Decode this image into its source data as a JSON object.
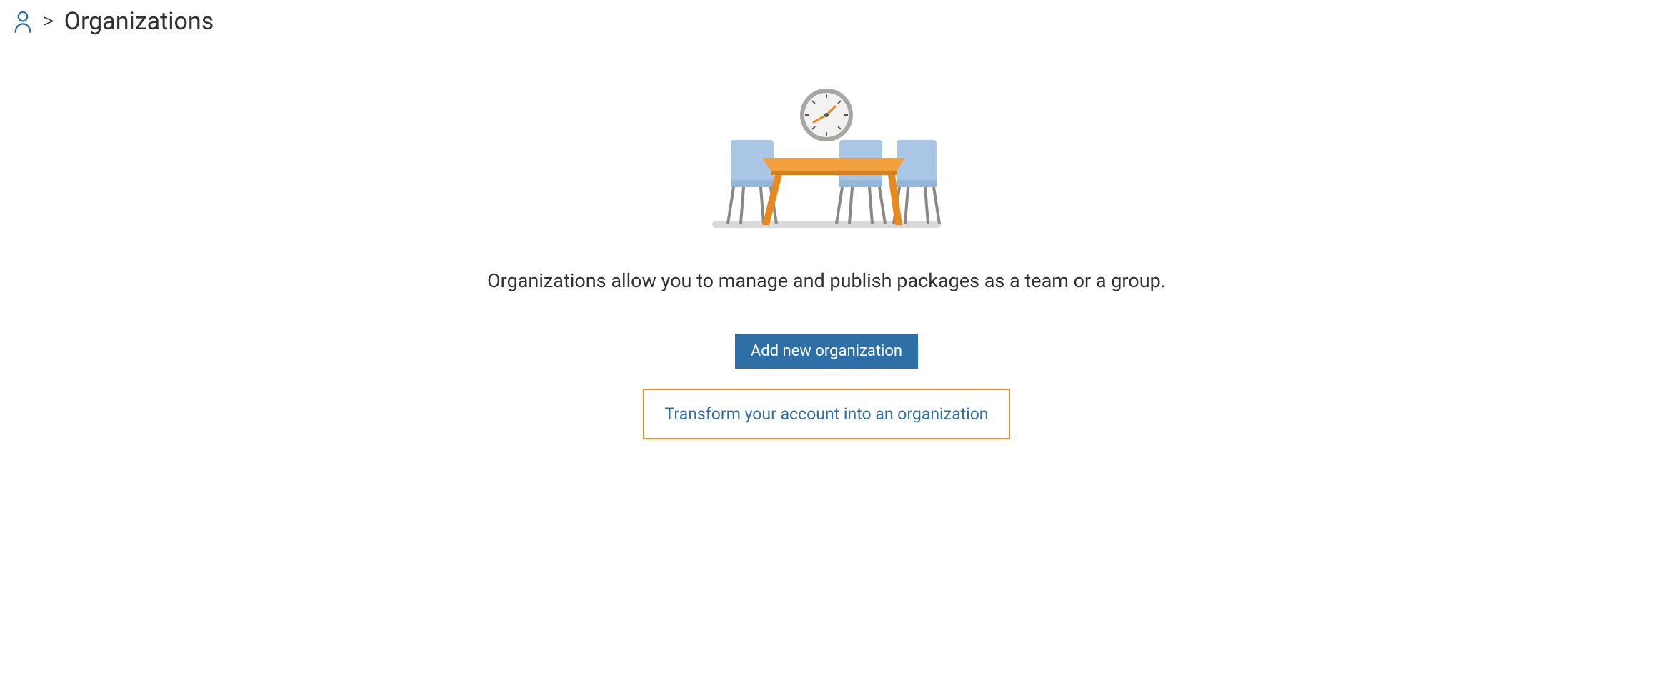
{
  "breadcrumb": {
    "title": "Organizations",
    "separator": ">"
  },
  "main": {
    "description": "Organizations allow you to manage and publish packages as a team or a group.",
    "add_button_label": "Add new organization",
    "transform_button_label": "Transform your account into an organization"
  },
  "icons": {
    "user": "user-icon"
  },
  "colors": {
    "primary_button_bg": "#2f6fa7",
    "outline_border": "#e98b2a",
    "link_text": "#2f6fa7"
  }
}
